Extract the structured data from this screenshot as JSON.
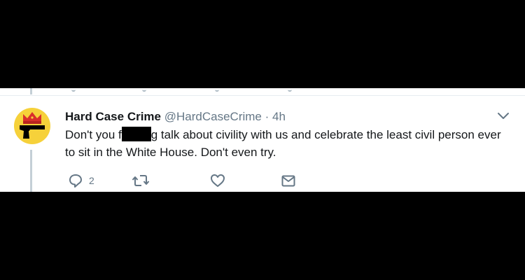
{
  "tweet": {
    "author_name": "Hard Case Crime",
    "author_handle": "@HardCaseCrime",
    "separator": "·",
    "time": "4h",
    "text_before": "Don't you f",
    "text_after": "g talk about civility with us and celebrate the least civil person ever to sit in the White House. Don't even try.",
    "reply_count": "2"
  },
  "icons": {
    "reply": "reply-icon",
    "retweet": "retweet-icon",
    "like": "heart-icon",
    "message": "envelope-icon",
    "menu": "chevron-down-icon",
    "avatar": "gun-crown-logo"
  },
  "colors": {
    "background": "#000000",
    "card": "#ffffff",
    "text": "#14171a",
    "secondary": "#657786",
    "action_icon": "#657786",
    "thread_line": "#c4cfd6"
  }
}
